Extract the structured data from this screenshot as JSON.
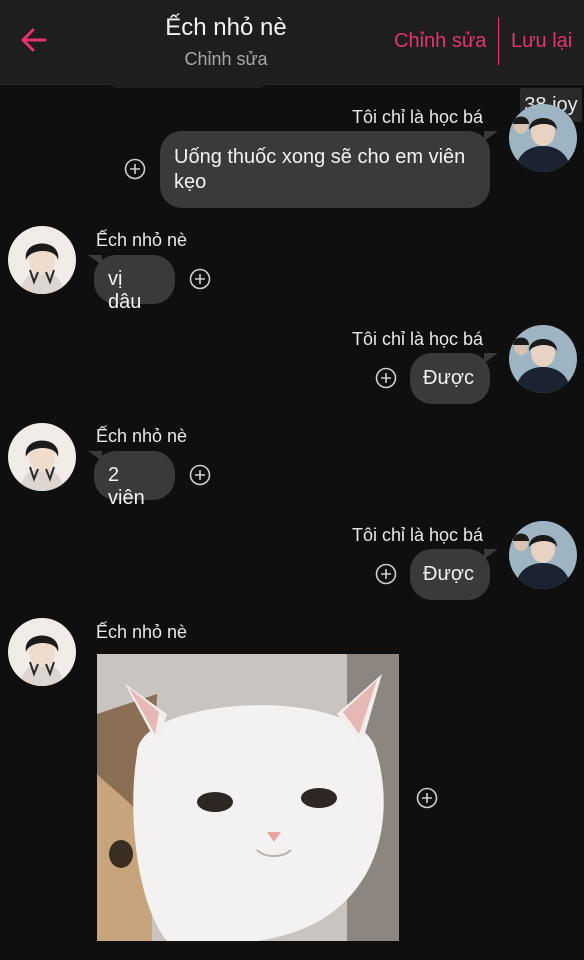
{
  "header": {
    "title": "Ếch nhỏ nè",
    "subtitle": "Chỉnh sửa",
    "edit_label": "Chỉnh sửa",
    "save_label": "Lưu lại",
    "accent": "#e5336f"
  },
  "badge": "38 joy",
  "messages": [
    {
      "sender": "Tôi chỉ là học bá",
      "side": "right",
      "line1": "Uống thuốc xong sẽ cho em viên",
      "line2": "kẹo"
    },
    {
      "sender": "Ếch nhỏ nè",
      "side": "left",
      "text": "vị dâu"
    },
    {
      "sender": "Tôi chỉ là học bá",
      "side": "right",
      "text": "Được"
    },
    {
      "sender": "Ếch nhỏ nè",
      "side": "left",
      "text": "2 viên"
    },
    {
      "sender": "Tôi chỉ là học bá",
      "side": "right",
      "text": "Được"
    },
    {
      "sender": "Ếch nhỏ nè",
      "side": "left",
      "type": "image",
      "image": "white-cat-photo"
    }
  ],
  "icons": {
    "back": "back-arrow-icon",
    "add": "add-reaction-icon"
  }
}
